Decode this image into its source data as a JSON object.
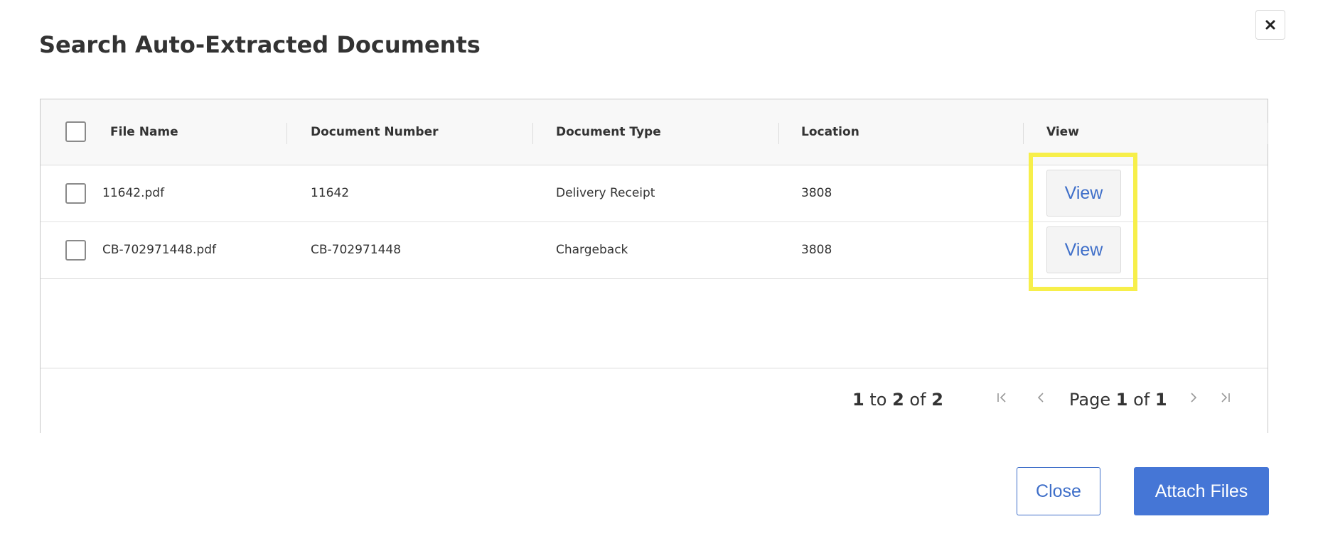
{
  "dialog": {
    "title": "Search Auto-Extracted Documents",
    "close_icon": "close-icon"
  },
  "table": {
    "headers": {
      "file_name": "File Name",
      "document_number": "Document Number",
      "document_type": "Document Type",
      "location": "Location",
      "view": "View"
    },
    "rows": [
      {
        "file_name": "11642.pdf",
        "document_number": "11642",
        "document_type": "Delivery Receipt",
        "location": "3808",
        "view_label": "View"
      },
      {
        "file_name": "CB-702971448.pdf",
        "document_number": "CB-702971448",
        "document_type": "Chargeback",
        "location": "3808",
        "view_label": "View"
      }
    ]
  },
  "pagination": {
    "from": "1",
    "to_word": "to",
    "to": "2",
    "of_word": "of",
    "total": "2",
    "page_word": "Page",
    "page": "1",
    "page_of_word": "of",
    "page_total": "1",
    "icons": [
      "first-page-icon",
      "previous-page-icon",
      "next-page-icon",
      "last-page-icon"
    ]
  },
  "footer": {
    "close_label": "Close",
    "attach_label": "Attach Files"
  },
  "colors": {
    "accent": "#4576d6",
    "link": "#3f6fc9",
    "highlight": "#f7ef4a"
  }
}
